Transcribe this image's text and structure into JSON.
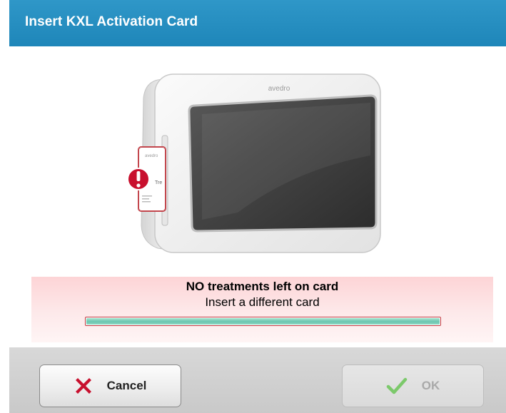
{
  "dialog": {
    "title": "Insert KXL Activation Card"
  },
  "device": {
    "brand": "avedro",
    "card_brand": "avedro",
    "card_text": "Tre"
  },
  "status": {
    "message": "NO treatments left on card",
    "instruction": "Insert a different card",
    "progress_percent": 100,
    "panel_color": "#fdd4d6",
    "progress_color": "#6bc5b0"
  },
  "buttons": {
    "cancel": {
      "label": "Cancel",
      "icon": "x-icon",
      "icon_color": "#c8102e"
    },
    "ok": {
      "label": "OK",
      "icon": "checkmark-icon",
      "icon_color": "#7cc96b",
      "enabled": false
    }
  },
  "colors": {
    "header": "#2f97c8",
    "alert_icon": "#c8102e"
  }
}
